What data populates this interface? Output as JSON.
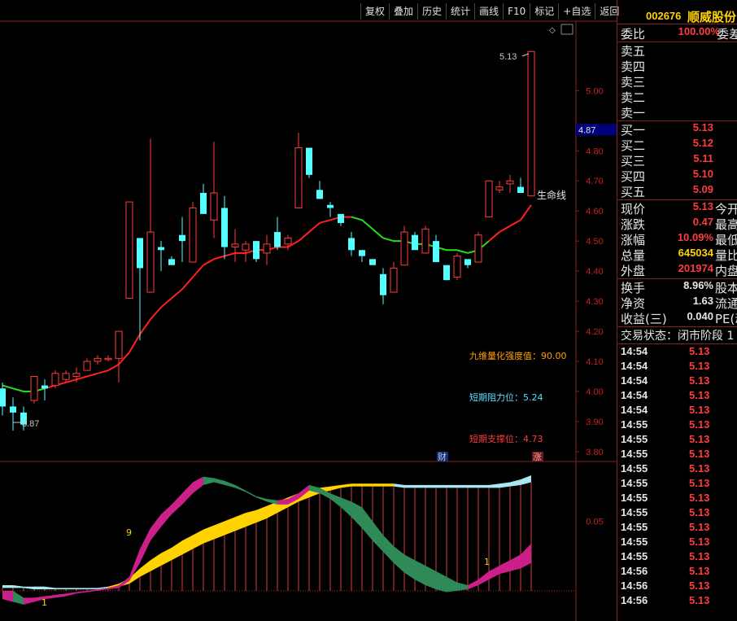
{
  "toolbar": {
    "buttons": [
      "复权",
      "叠加",
      "历史",
      "统计",
      "画线",
      "F10",
      "标记",
      "+自选",
      "返回"
    ]
  },
  "chart": {
    "y_axis_ticks": [
      "5.00",
      "4.80",
      "4.70",
      "4.60",
      "4.50",
      "4.40",
      "4.30",
      "4.20",
      "4.10",
      "4.00",
      "3.90",
      "3.80"
    ],
    "current_price_tag": "4.87",
    "high_label": "5.13",
    "low_label": "3.87",
    "lifeline_label": "生命线",
    "indicator_strength": "九维量化强度值：90.00",
    "resistance": "短期阻力位：5.24",
    "support": "短期支撑位：4.73",
    "badge_cai": "财",
    "badge_zhang": "涨",
    "sub_axis_tick": "0.05",
    "sub_label_9": "9",
    "sub_label_1a": "1",
    "sub_label_1b": "1",
    "colors": {
      "up": "#ff3c3c",
      "down": "#54ffff",
      "ma_red": "#ff2020",
      "ma_green": "#20e020",
      "magenta": "#cc1f8a",
      "gold": "#ffd200",
      "teal": "#2e8b57",
      "lightblue": "#a8e8f0"
    }
  },
  "quote": {
    "code": "002676",
    "name": "顺威股份",
    "weibi_label": "委比",
    "weibi_value": "100.00%",
    "weicha_label": "委差",
    "sell_labels": [
      "卖五",
      "卖四",
      "卖三",
      "卖二",
      "卖一"
    ],
    "buy": [
      {
        "label": "买一",
        "price": "5.13"
      },
      {
        "label": "买二",
        "price": "5.12"
      },
      {
        "label": "买三",
        "price": "5.11"
      },
      {
        "label": "买四",
        "price": "5.10"
      },
      {
        "label": "买五",
        "price": "5.09"
      }
    ],
    "stats": [
      {
        "label": "现价",
        "value": "5.13",
        "color": "red",
        "right": "今开"
      },
      {
        "label": "涨跌",
        "value": "0.47",
        "color": "red",
        "right": "最高"
      },
      {
        "label": "涨幅",
        "value": "10.09%",
        "color": "red",
        "right": "最低"
      },
      {
        "label": "总量",
        "value": "645034",
        "color": "yellow",
        "right": "量比"
      },
      {
        "label": "外盘",
        "value": "201974",
        "color": "red",
        "right": "内盘"
      }
    ],
    "stats2": [
      {
        "label": "换手",
        "value": "8.96%",
        "right": "股本"
      },
      {
        "label": "净资",
        "value": "1.63",
        "right": "流通"
      },
      {
        "label": "收益(三)",
        "value": "0.040",
        "right": "PE(动"
      }
    ],
    "trade_status": "交易状态：闭市阶段 1",
    "ticks": [
      {
        "time": "14:54",
        "price": "5.13"
      },
      {
        "time": "14:54",
        "price": "5.13"
      },
      {
        "time": "14:54",
        "price": "5.13"
      },
      {
        "time": "14:54",
        "price": "5.13"
      },
      {
        "time": "14:54",
        "price": "5.13"
      },
      {
        "time": "14:55",
        "price": "5.13"
      },
      {
        "time": "14:55",
        "price": "5.13"
      },
      {
        "time": "14:55",
        "price": "5.13"
      },
      {
        "time": "14:55",
        "price": "5.13"
      },
      {
        "time": "14:55",
        "price": "5.13"
      },
      {
        "time": "14:55",
        "price": "5.13"
      },
      {
        "time": "14:55",
        "price": "5.13"
      },
      {
        "time": "14:55",
        "price": "5.13"
      },
      {
        "time": "14:55",
        "price": "5.13"
      },
      {
        "time": "14:55",
        "price": "5.13"
      },
      {
        "time": "14:56",
        "price": "5.13"
      },
      {
        "time": "14:56",
        "price": "5.13"
      },
      {
        "time": "14:56",
        "price": "5.13"
      }
    ]
  },
  "chart_data": {
    "type": "candlestick",
    "title": "",
    "ylim": [
      3.77,
      5.22
    ],
    "candles": [
      {
        "o": 4.01,
        "h": 4.03,
        "l": 3.92,
        "c": 3.95
      },
      {
        "o": 3.95,
        "h": 3.98,
        "l": 3.87,
        "c": 3.93
      },
      {
        "o": 3.93,
        "h": 3.95,
        "l": 3.87,
        "c": 3.89
      },
      {
        "o": 3.97,
        "h": 4.05,
        "l": 3.96,
        "c": 4.05
      },
      {
        "o": 4.02,
        "h": 4.04,
        "l": 3.97,
        "c": 4.01
      },
      {
        "o": 4.02,
        "h": 4.07,
        "l": 4.01,
        "c": 4.06
      },
      {
        "o": 4.04,
        "h": 4.07,
        "l": 4.03,
        "c": 4.06
      },
      {
        "o": 4.05,
        "h": 4.08,
        "l": 4.03,
        "c": 4.06
      },
      {
        "o": 4.07,
        "h": 4.11,
        "l": 4.07,
        "c": 4.1
      },
      {
        "o": 4.1,
        "h": 4.12,
        "l": 4.09,
        "c": 4.11
      },
      {
        "o": 4.11,
        "h": 4.12,
        "l": 4.1,
        "c": 4.11
      },
      {
        "o": 4.11,
        "h": 4.19,
        "l": 4.03,
        "c": 4.2
      },
      {
        "o": 4.31,
        "h": 4.63,
        "l": 4.31,
        "c": 4.63
      },
      {
        "o": 4.51,
        "h": 4.51,
        "l": 4.17,
        "c": 4.41
      },
      {
        "o": 4.33,
        "h": 4.84,
        "l": 4.33,
        "c": 4.53
      },
      {
        "o": 4.48,
        "h": 4.5,
        "l": 4.4,
        "c": 4.47
      },
      {
        "o": 4.44,
        "h": 4.45,
        "l": 4.43,
        "c": 4.42
      },
      {
        "o": 4.52,
        "h": 4.58,
        "l": 4.43,
        "c": 4.5
      },
      {
        "o": 4.43,
        "h": 4.63,
        "l": 4.43,
        "c": 4.61
      },
      {
        "o": 4.66,
        "h": 4.69,
        "l": 4.6,
        "c": 4.59
      },
      {
        "o": 4.57,
        "h": 4.83,
        "l": 4.51,
        "c": 4.66
      },
      {
        "o": 4.61,
        "h": 4.65,
        "l": 4.44,
        "c": 4.48
      },
      {
        "o": 4.48,
        "h": 4.54,
        "l": 4.43,
        "c": 4.49
      },
      {
        "o": 4.47,
        "h": 4.5,
        "l": 4.43,
        "c": 4.49
      },
      {
        "o": 4.5,
        "h": 4.5,
        "l": 4.43,
        "c": 4.44
      },
      {
        "o": 4.46,
        "h": 4.52,
        "l": 4.42,
        "c": 4.49
      },
      {
        "o": 4.53,
        "h": 4.58,
        "l": 4.47,
        "c": 4.48
      },
      {
        "o": 4.49,
        "h": 4.52,
        "l": 4.47,
        "c": 4.51
      },
      {
        "o": 4.61,
        "h": 4.86,
        "l": 4.61,
        "c": 4.81
      },
      {
        "o": 4.81,
        "h": 4.79,
        "l": 4.71,
        "c": 4.72
      },
      {
        "o": 4.67,
        "h": 4.7,
        "l": 4.64,
        "c": 4.64
      },
      {
        "o": 4.62,
        "h": 4.63,
        "l": 4.58,
        "c": 4.61
      },
      {
        "o": 4.59,
        "h": 4.57,
        "l": 4.55,
        "c": 4.56
      },
      {
        "o": 4.51,
        "h": 4.53,
        "l": 4.45,
        "c": 4.47
      },
      {
        "o": 4.47,
        "h": 4.47,
        "l": 4.43,
        "c": 4.45
      },
      {
        "o": 4.44,
        "h": 4.44,
        "l": 4.42,
        "c": 4.42
      },
      {
        "o": 4.39,
        "h": 4.41,
        "l": 4.29,
        "c": 4.32
      },
      {
        "o": 4.33,
        "h": 4.43,
        "l": 4.33,
        "c": 4.41
      },
      {
        "o": 4.42,
        "h": 4.55,
        "l": 4.42,
        "c": 4.53
      },
      {
        "o": 4.52,
        "h": 4.53,
        "l": 4.49,
        "c": 4.47
      },
      {
        "o": 4.46,
        "h": 4.55,
        "l": 4.46,
        "c": 4.54
      },
      {
        "o": 4.5,
        "h": 4.52,
        "l": 4.45,
        "c": 4.43
      },
      {
        "o": 4.42,
        "h": 4.42,
        "l": 4.37,
        "c": 4.37
      },
      {
        "o": 4.38,
        "h": 4.46,
        "l": 4.37,
        "c": 4.45
      },
      {
        "o": 4.44,
        "h": 4.44,
        "l": 4.41,
        "c": 4.42
      },
      {
        "o": 4.43,
        "h": 4.53,
        "l": 4.43,
        "c": 4.52
      },
      {
        "o": 4.58,
        "h": 4.68,
        "l": 4.58,
        "c": 4.7
      },
      {
        "o": 4.67,
        "h": 4.7,
        "l": 4.66,
        "c": 4.68
      },
      {
        "o": 4.69,
        "h": 4.72,
        "l": 4.66,
        "c": 4.7
      },
      {
        "o": 4.68,
        "h": 4.71,
        "l": 4.66,
        "c": 4.66
      },
      {
        "o": 4.65,
        "h": 5.13,
        "l": 4.65,
        "c": 5.13
      }
    ],
    "lifeline": [
      4.02,
      4.01,
      4.0,
      4.0,
      4.01,
      4.02,
      4.03,
      4.04,
      4.05,
      4.06,
      4.07,
      4.09,
      4.13,
      4.19,
      4.24,
      4.28,
      4.31,
      4.34,
      4.38,
      4.42,
      4.44,
      4.45,
      4.46,
      4.46,
      4.47,
      4.47,
      4.48,
      4.48,
      4.5,
      4.53,
      4.56,
      4.57,
      4.58,
      4.58,
      4.57,
      4.54,
      4.51,
      4.5,
      4.5,
      4.49,
      4.49,
      4.48,
      4.47,
      4.47,
      4.46,
      4.47,
      4.5,
      4.53,
      4.55,
      4.57,
      4.62
    ],
    "lifeline_green_ranges": [
      [
        0,
        3
      ],
      [
        33,
        45
      ]
    ],
    "sub_ylim": [
      -0.02,
      0.09
    ],
    "sub_band_a_upper": [
      0.0,
      0.0,
      -0.005,
      -0.005,
      -0.004,
      -0.003,
      -0.002,
      -0.001,
      0.0,
      0.001,
      0.002,
      0.004,
      0.01,
      0.03,
      0.045,
      0.055,
      0.062,
      0.07,
      0.078,
      0.082,
      0.081,
      0.079,
      0.076,
      0.072,
      0.068,
      0.066,
      0.065,
      0.066,
      0.07,
      0.076,
      0.074,
      0.07,
      0.067,
      0.064,
      0.06,
      0.05,
      0.04,
      0.032,
      0.026,
      0.022,
      0.018,
      0.014,
      0.01,
      0.006,
      0.004,
      0.008,
      0.014,
      0.018,
      0.022,
      0.026,
      0.034
    ],
    "sub_band_a_lower": [
      -0.006,
      -0.008,
      -0.01,
      -0.008,
      -0.006,
      -0.005,
      -0.004,
      -0.002,
      -0.001,
      0.0,
      0.001,
      0.002,
      0.007,
      0.02,
      0.036,
      0.046,
      0.055,
      0.062,
      0.07,
      0.076,
      0.078,
      0.076,
      0.074,
      0.071,
      0.067,
      0.064,
      0.062,
      0.062,
      0.066,
      0.072,
      0.07,
      0.066,
      0.06,
      0.053,
      0.045,
      0.036,
      0.028,
      0.02,
      0.013,
      0.008,
      0.004,
      0.001,
      -0.001,
      0.0,
      0.001,
      0.004,
      0.008,
      0.012,
      0.014,
      0.016,
      0.02
    ],
    "sub_band_b_upper": [
      0.004,
      0.004,
      0.003,
      0.003,
      0.003,
      0.002,
      0.002,
      0.002,
      0.002,
      0.002,
      0.003,
      0.005,
      0.009,
      0.016,
      0.022,
      0.027,
      0.031,
      0.036,
      0.04,
      0.044,
      0.047,
      0.05,
      0.053,
      0.056,
      0.058,
      0.061,
      0.064,
      0.067,
      0.07,
      0.072,
      0.074,
      0.075,
      0.076,
      0.077,
      0.077,
      0.077,
      0.077,
      0.077,
      0.076,
      0.076,
      0.076,
      0.076,
      0.076,
      0.076,
      0.076,
      0.076,
      0.076,
      0.077,
      0.078,
      0.08,
      0.083
    ],
    "sub_band_b_lower": [
      0.002,
      0.002,
      0.002,
      0.001,
      0.001,
      0.001,
      0.001,
      0.001,
      0.001,
      0.001,
      0.002,
      0.003,
      0.005,
      0.01,
      0.014,
      0.018,
      0.022,
      0.026,
      0.03,
      0.034,
      0.037,
      0.04,
      0.043,
      0.046,
      0.049,
      0.052,
      0.056,
      0.06,
      0.064,
      0.067,
      0.07,
      0.072,
      0.074,
      0.075,
      0.075,
      0.075,
      0.075,
      0.075,
      0.074,
      0.074,
      0.074,
      0.074,
      0.074,
      0.074,
      0.074,
      0.074,
      0.074,
      0.074,
      0.075,
      0.076,
      0.078
    ]
  }
}
